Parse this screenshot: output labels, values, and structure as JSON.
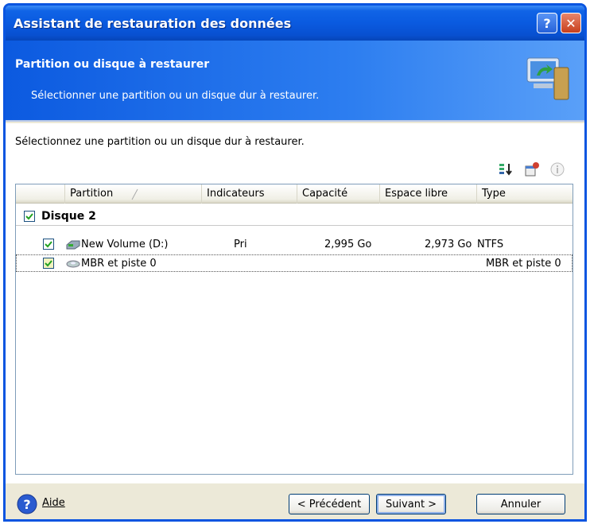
{
  "window": {
    "title": "Assistant de restauration des données",
    "help_glyph": "?",
    "close_glyph": "✕"
  },
  "header": {
    "title": "Partition ou disque à restaurer",
    "subtitle": "Sélectionner une partition ou un disque dur à restaurer."
  },
  "content": {
    "instruction": "Sélectionnez une partition ou un disque dur à restaurer.",
    "columns": [
      "Partition",
      "Indicateurs",
      "Capacité",
      "Espace libre",
      "Type"
    ],
    "group": {
      "label": "Disque 2",
      "checked": true
    },
    "rows": [
      {
        "name": "New Volume (D:)",
        "flags": "Pri",
        "capacity": "2,995 Go",
        "free": "2,973 Go",
        "type": "NTFS",
        "checked": true
      },
      {
        "name": "MBR et piste 0",
        "flags": "",
        "capacity": "",
        "free": "",
        "type": "MBR et piste 0",
        "checked": true
      }
    ]
  },
  "footer": {
    "help_label": "Aide",
    "back_label": "< Précédent",
    "next_label": "Suivant >",
    "cancel_label": "Annuler"
  },
  "colors": {
    "title_bar": "#0a5ae0",
    "header_bg": "#2d7ef0",
    "face": "#ece9d8"
  }
}
